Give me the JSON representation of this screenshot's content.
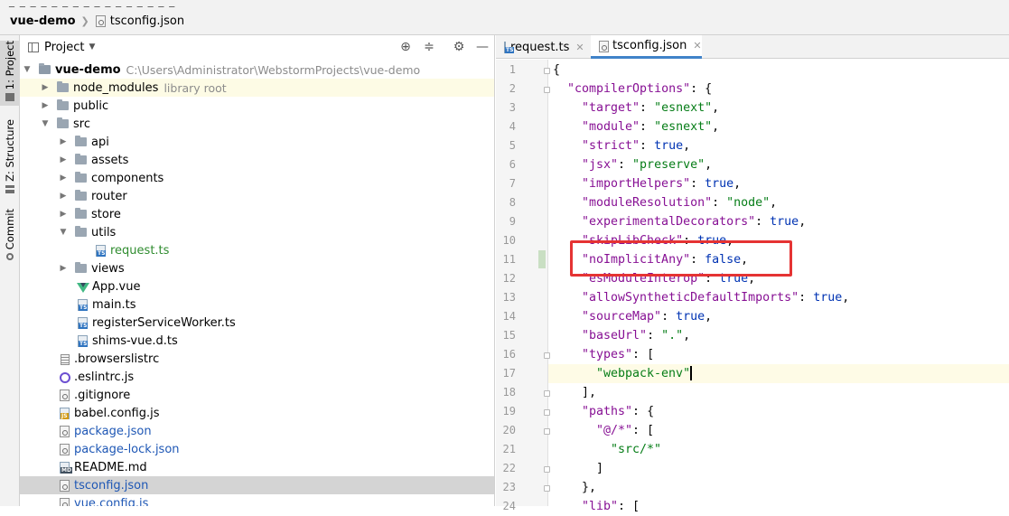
{
  "breadcrumb": {
    "project": "vue-demo",
    "file": "tsconfig.json"
  },
  "toolwindows": [
    {
      "label": "1: Project"
    },
    {
      "label": "Z: Structure"
    },
    {
      "label": "Commit"
    }
  ],
  "project_panel": {
    "title": "Project",
    "tree": [
      {
        "label": "vue-demo",
        "hint": "C:\\Users\\Administrator\\WebstormProjects\\vue-demo"
      },
      {
        "label": "node_modules",
        "hint": "library root"
      },
      {
        "label": "public"
      },
      {
        "label": "src"
      },
      {
        "label": "api"
      },
      {
        "label": "assets"
      },
      {
        "label": "components"
      },
      {
        "label": "router"
      },
      {
        "label": "store"
      },
      {
        "label": "utils"
      },
      {
        "label": "request.ts"
      },
      {
        "label": "views"
      },
      {
        "label": "App.vue"
      },
      {
        "label": "main.ts"
      },
      {
        "label": "registerServiceWorker.ts"
      },
      {
        "label": "shims-vue.d.ts"
      },
      {
        "label": ".browserslistrc"
      },
      {
        "label": ".eslintrc.js"
      },
      {
        "label": ".gitignore"
      },
      {
        "label": "babel.config.js"
      },
      {
        "label": "package.json"
      },
      {
        "label": "package-lock.json"
      },
      {
        "label": "README.md"
      },
      {
        "label": "tsconfig.json"
      },
      {
        "label": "vue.config.js"
      }
    ]
  },
  "editor": {
    "tabs": [
      {
        "label": "request.ts",
        "close": "✕"
      },
      {
        "label": "tsconfig.json",
        "close": "✕"
      }
    ],
    "lines": [
      {
        "n": "1",
        "text": "{"
      },
      {
        "n": "2",
        "text": "\"compilerOptions\": {"
      },
      {
        "n": "3",
        "key": "\"target\"",
        "val": "\"esnext\""
      },
      {
        "n": "4",
        "key": "\"module\"",
        "val": "\"esnext\""
      },
      {
        "n": "5",
        "key": "\"strict\"",
        "val": "true"
      },
      {
        "n": "6",
        "key": "\"jsx\"",
        "val": "\"preserve\""
      },
      {
        "n": "7",
        "key": "\"importHelpers\"",
        "val": "true"
      },
      {
        "n": "8",
        "key": "\"moduleResolution\"",
        "val": "\"node\""
      },
      {
        "n": "9",
        "key": "\"experimentalDecorators\"",
        "val": "true"
      },
      {
        "n": "10",
        "key": "\"skipLibCheck\"",
        "val": "true"
      },
      {
        "n": "11",
        "key": "\"noImplicitAny\"",
        "val": "false"
      },
      {
        "n": "12",
        "key": "\"esModuleInterop\"",
        "val": "true"
      },
      {
        "n": "13",
        "key": "\"allowSyntheticDefaultImports\"",
        "val": "true"
      },
      {
        "n": "14",
        "key": "\"sourceMap\"",
        "val": "true"
      },
      {
        "n": "15",
        "key": "\"baseUrl\"",
        "val": "\".\""
      },
      {
        "n": "16",
        "key": "\"types\"",
        "text": "["
      },
      {
        "n": "17",
        "val": "\"webpack-env\""
      },
      {
        "n": "18",
        "text": "],"
      },
      {
        "n": "19",
        "key": "\"paths\"",
        "text": "{"
      },
      {
        "n": "20",
        "key": "\"@/*\"",
        "text": "["
      },
      {
        "n": "21",
        "val": "\"src/*\""
      },
      {
        "n": "22",
        "text": "]"
      },
      {
        "n": "23",
        "text": "},"
      },
      {
        "n": "24",
        "key": "\"lib\"",
        "text": "["
      }
    ]
  }
}
